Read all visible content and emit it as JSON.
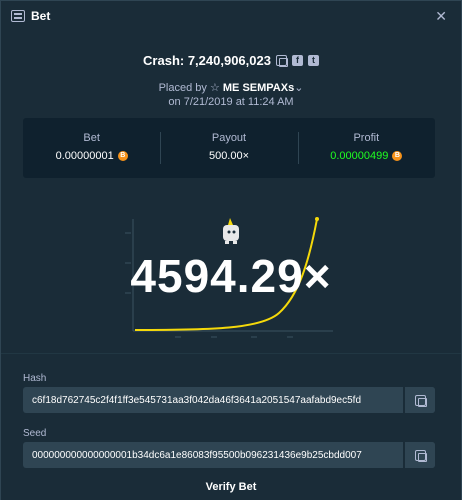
{
  "header": {
    "title": "Bet"
  },
  "crash": {
    "text": "Crash: 7,240,906,023"
  },
  "placed": {
    "prefix": "Placed by",
    "user": "ME SEMPAXs",
    "date": "on 7/21/2019 at 11:24 AM"
  },
  "stats": [
    {
      "label": "Bet",
      "value": "0.00000001",
      "coin": true
    },
    {
      "label": "Payout",
      "value": "500.00×",
      "coin": false
    },
    {
      "label": "Profit",
      "value": "0.00000499",
      "coin": true
    }
  ],
  "multiplier": "4594.29×",
  "hash": {
    "label": "Hash",
    "value": "c6f18d762745c2f4f1ff3e545731aa3f042da46f3641a2051547aafabd9ec5fd"
  },
  "seed": {
    "label": "Seed",
    "value": "000000000000000001b34dc6a1e86083f95500b096231436e9b25cbdd007"
  },
  "verify": {
    "label": "Verify Bet"
  },
  "colors": {
    "accent_green": "#1fff20",
    "curve": "#f5d90a",
    "coin": "#f7931a"
  }
}
